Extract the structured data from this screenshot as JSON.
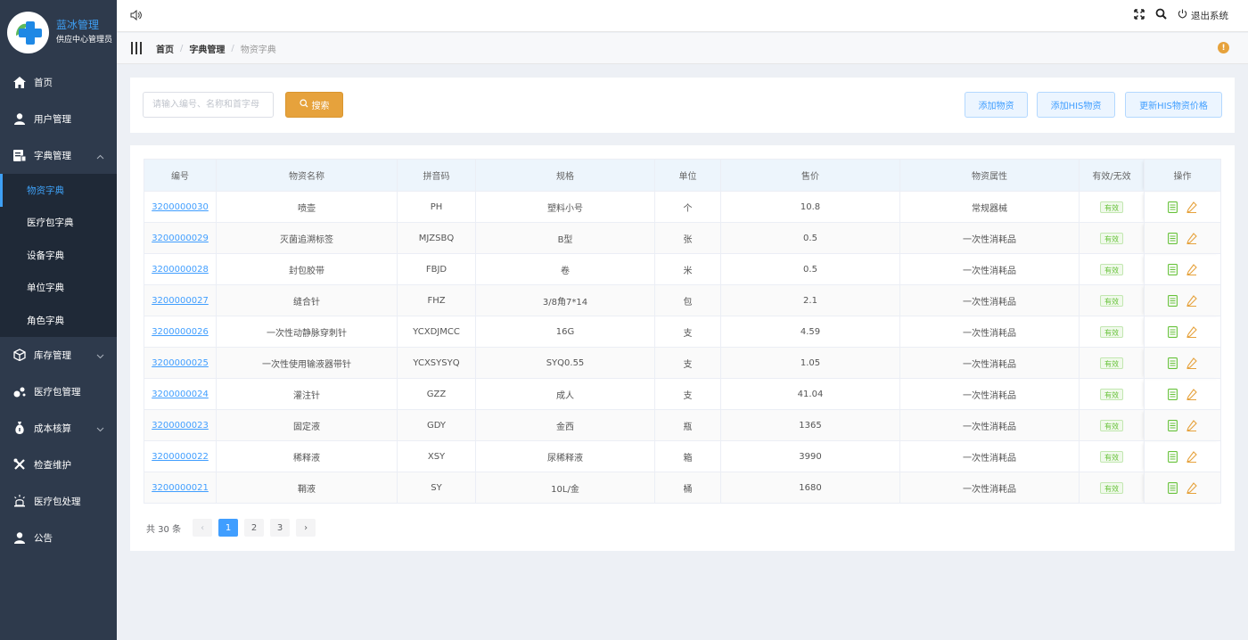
{
  "brand": {
    "title": "蓝冰管理",
    "subtitle": "供应中心管理员"
  },
  "sidebar": {
    "items": [
      {
        "label": "首页"
      },
      {
        "label": "用户管理"
      },
      {
        "label": "字典管理"
      },
      {
        "label": "库存管理"
      },
      {
        "label": "医疗包管理"
      },
      {
        "label": "成本核算"
      },
      {
        "label": "检查维护"
      },
      {
        "label": "医疗包处理"
      },
      {
        "label": "公告"
      }
    ],
    "submenu": [
      {
        "label": "物资字典"
      },
      {
        "label": "医疗包字典"
      },
      {
        "label": "设备字典"
      },
      {
        "label": "单位字典"
      },
      {
        "label": "角色字典"
      }
    ]
  },
  "topbar": {
    "logout_label": "退出系统"
  },
  "breadcrumb": {
    "home": "首页",
    "level2": "字典管理",
    "current": "物资字典"
  },
  "search": {
    "placeholder": "请输入编号、名称和首字母",
    "button_label": "搜索",
    "add_label": "添加物资",
    "add_his_label": "添加HIS物资",
    "update_his_label": "更新HIS物资价格"
  },
  "table": {
    "headers": [
      "编号",
      "物资名称",
      "拼音码",
      "规格",
      "单位",
      "售价",
      "物资属性",
      "有效/无效",
      "操作"
    ],
    "rows": [
      {
        "code": "3200000030",
        "name": "喷壶",
        "pinyin": "PH",
        "spec": "塑料小号",
        "unit": "个",
        "price": "10.8",
        "attr": "常规器械",
        "status": "有效"
      },
      {
        "code": "3200000029",
        "name": "灭菌追溯标签",
        "pinyin": "MJZSBQ",
        "spec": "B型",
        "unit": "张",
        "price": "0.5",
        "attr": "一次性消耗品",
        "status": "有效"
      },
      {
        "code": "3200000028",
        "name": "封包胶带",
        "pinyin": "FBJD",
        "spec": "卷",
        "unit": "米",
        "price": "0.5",
        "attr": "一次性消耗品",
        "status": "有效"
      },
      {
        "code": "3200000027",
        "name": "缝合针",
        "pinyin": "FHZ",
        "spec": "3/8角7*14",
        "unit": "包",
        "price": "2.1",
        "attr": "一次性消耗品",
        "status": "有效"
      },
      {
        "code": "3200000026",
        "name": "一次性动静脉穿刺针",
        "pinyin": "YCXDJMCC",
        "spec": "16G",
        "unit": "支",
        "price": "4.59",
        "attr": "一次性消耗品",
        "status": "有效"
      },
      {
        "code": "3200000025",
        "name": "一次性使用输液器带针",
        "pinyin": "YCXSYSYQ",
        "spec": "SYQ0.55",
        "unit": "支",
        "price": "1.05",
        "attr": "一次性消耗品",
        "status": "有效"
      },
      {
        "code": "3200000024",
        "name": "灌注针",
        "pinyin": "GZZ",
        "spec": "成人",
        "unit": "支",
        "price": "41.04",
        "attr": "一次性消耗品",
        "status": "有效"
      },
      {
        "code": "3200000023",
        "name": "固定液",
        "pinyin": "GDY",
        "spec": "金西",
        "unit": "瓶",
        "price": "1365",
        "attr": "一次性消耗品",
        "status": "有效"
      },
      {
        "code": "3200000022",
        "name": "稀释液",
        "pinyin": "XSY",
        "spec": "尿稀释液",
        "unit": "箱",
        "price": "3990",
        "attr": "一次性消耗品",
        "status": "有效"
      },
      {
        "code": "3200000021",
        "name": "鞘液",
        "pinyin": "SY",
        "spec": "10L/金",
        "unit": "桶",
        "price": "1680",
        "attr": "一次性消耗品",
        "status": "有效"
      }
    ]
  },
  "pagination": {
    "total_text": "共 30 条",
    "pages": [
      "1",
      "2",
      "3"
    ],
    "current": "1",
    "prev": "‹",
    "next": "›"
  },
  "colors": {
    "sidebar": "#2e3a4c",
    "accent": "#409eff",
    "search_button": "#e6a23c",
    "valid_tag": "#67c23a"
  }
}
